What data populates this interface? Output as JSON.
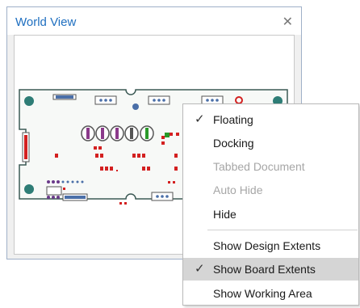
{
  "panel": {
    "title": "World View",
    "close_icon": "close-icon"
  },
  "menu": {
    "items": [
      {
        "label": "Floating",
        "checked": true,
        "disabled": false,
        "highlighted": false
      },
      {
        "label": "Docking",
        "checked": false,
        "disabled": false,
        "highlighted": false
      },
      {
        "label": "Tabbed Document",
        "checked": false,
        "disabled": true,
        "highlighted": false
      },
      {
        "label": "Auto Hide",
        "checked": false,
        "disabled": true,
        "highlighted": false
      },
      {
        "label": "Hide",
        "checked": false,
        "disabled": false,
        "highlighted": false
      },
      {
        "label": "Show Design Extents",
        "checked": false,
        "disabled": false,
        "highlighted": false
      },
      {
        "label": "Show Board Extents",
        "checked": true,
        "disabled": false,
        "highlighted": true
      },
      {
        "label": "Show Working Area",
        "checked": false,
        "disabled": false,
        "highlighted": false
      }
    ],
    "check_glyph": "✓"
  },
  "colors": {
    "title": "#1f6fc0",
    "board_outline": "#2f4f4f",
    "pad_red": "#d32020",
    "hole_teal": "#2e7d76"
  }
}
